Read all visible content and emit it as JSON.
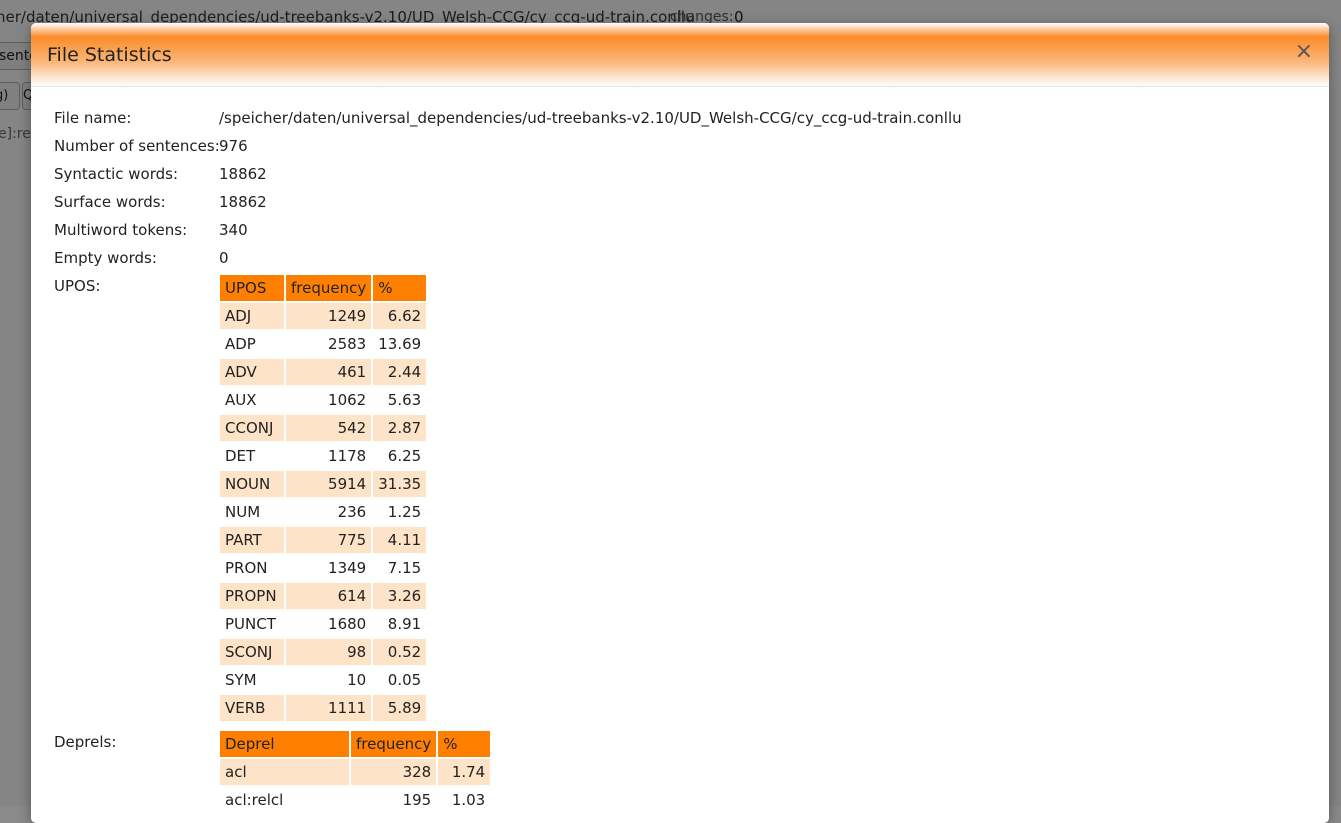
{
  "background": {
    "path": "her/daten/universal_dependencies/ud-treebanks-v2.10/UD_Welsh-CCG/cy_ccg-ud-train.conllu",
    "changes_label": "changes:",
    "changes_value": "0",
    "sentence_button_label": "sente",
    "regex_button_label": "g)",
    "q_button_label": "Q",
    "regex_text": "e]:reg"
  },
  "modal": {
    "title": "File Statistics",
    "close_icon": "×"
  },
  "stats": {
    "file_name_label": "File name:",
    "file_name": "/speicher/daten/universal_dependencies/ud-treebanks-v2.10/UD_Welsh-CCG/cy_ccg-ud-train.conllu",
    "sentences_label": "Number of sentences:",
    "sentences": "976",
    "syntactic_label": "Syntactic words:",
    "syntactic": "18862",
    "surface_label": "Surface words:",
    "surface": "18862",
    "multiword_label": "Multiword tokens:",
    "multiword": "340",
    "empty_label": "Empty words:",
    "empty": "0",
    "upos_label": "UPOS:",
    "deprels_label": "Deprels:"
  },
  "upos_table": {
    "headers": [
      "UPOS",
      "frequency",
      "%"
    ],
    "rows": [
      [
        "ADJ",
        "1249",
        "6.62"
      ],
      [
        "ADP",
        "2583",
        "13.69"
      ],
      [
        "ADV",
        "461",
        "2.44"
      ],
      [
        "AUX",
        "1062",
        "5.63"
      ],
      [
        "CCONJ",
        "542",
        "2.87"
      ],
      [
        "DET",
        "1178",
        "6.25"
      ],
      [
        "NOUN",
        "5914",
        "31.35"
      ],
      [
        "NUM",
        "236",
        "1.25"
      ],
      [
        "PART",
        "775",
        "4.11"
      ],
      [
        "PRON",
        "1349",
        "7.15"
      ],
      [
        "PROPN",
        "614",
        "3.26"
      ],
      [
        "PUNCT",
        "1680",
        "8.91"
      ],
      [
        "SCONJ",
        "98",
        "0.52"
      ],
      [
        "SYM",
        "10",
        "0.05"
      ],
      [
        "VERB",
        "1111",
        "5.89"
      ]
    ]
  },
  "deprel_table": {
    "headers": [
      "Deprel",
      "frequency",
      "%"
    ],
    "rows": [
      [
        "acl",
        "328",
        "1.74"
      ],
      [
        "acl:relcl",
        "195",
        "1.03"
      ]
    ]
  },
  "colors": {
    "header_orange": "#ff8000",
    "row_shade": "#fde3c8"
  }
}
